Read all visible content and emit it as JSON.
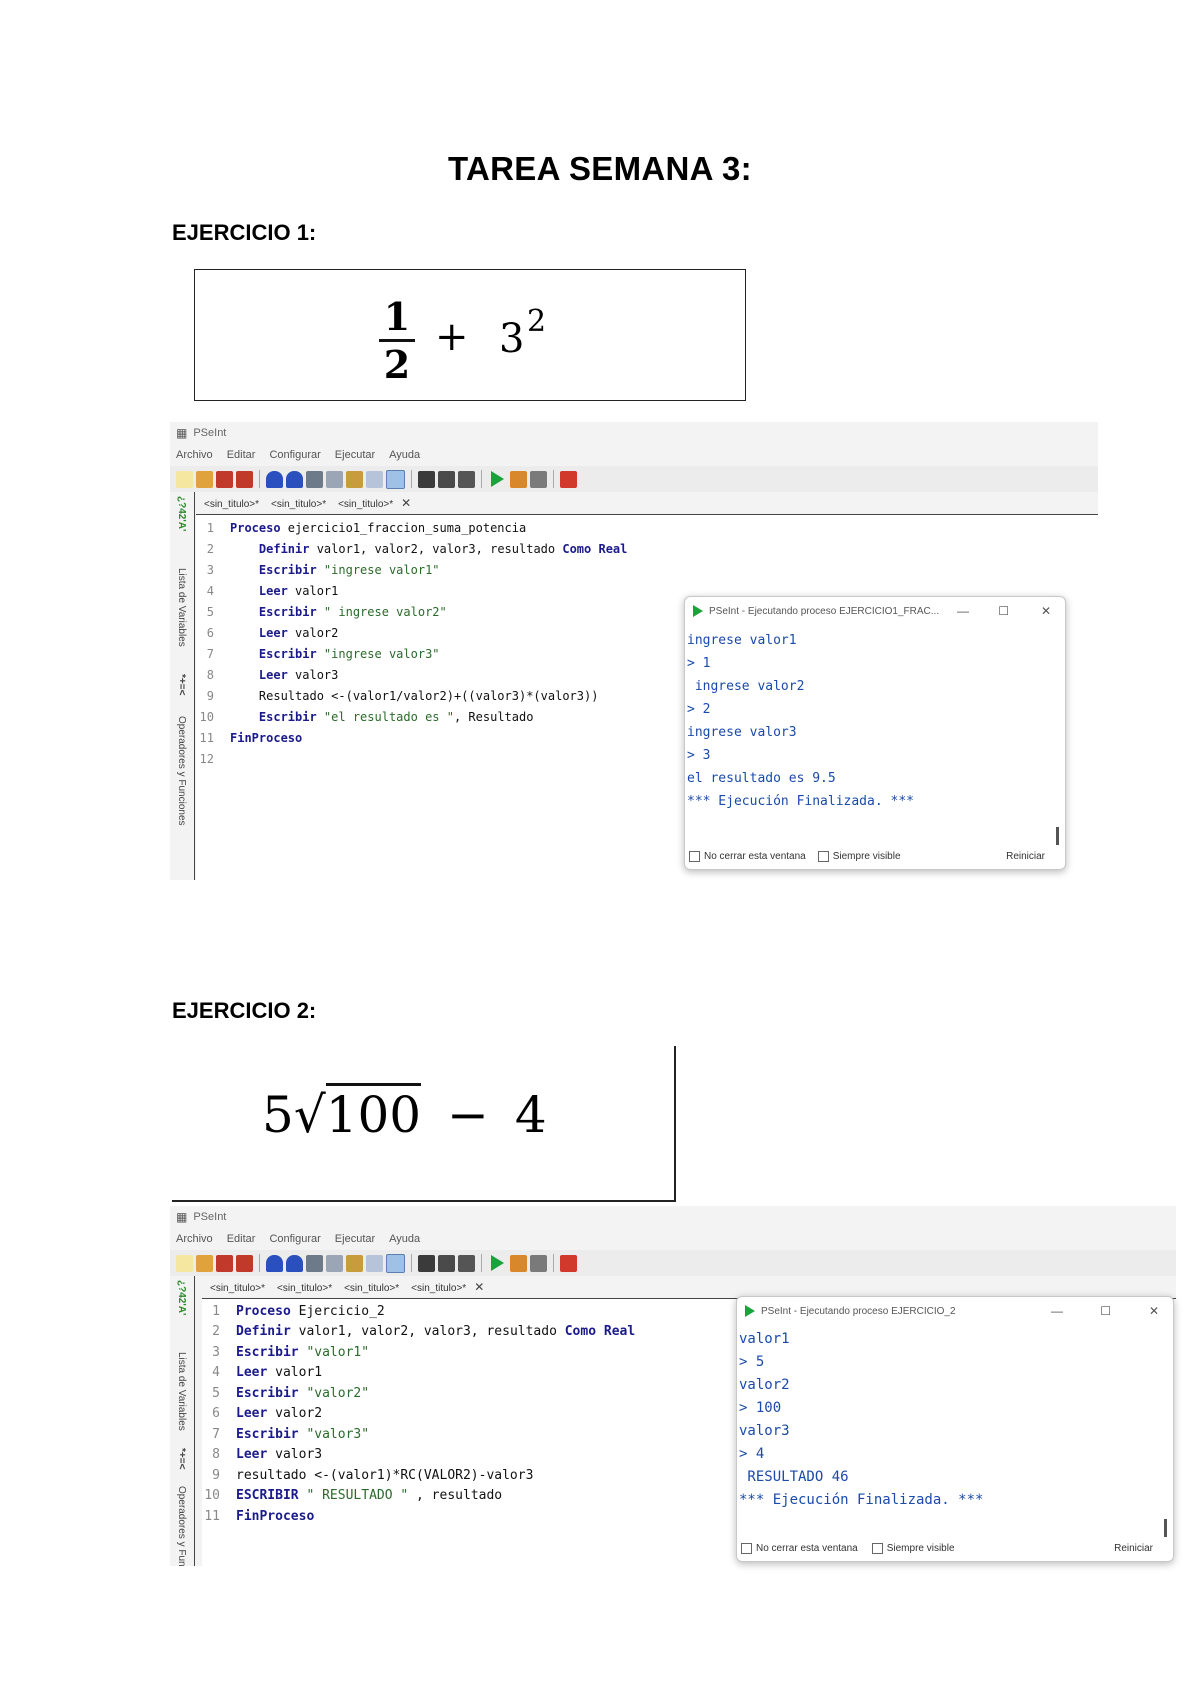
{
  "document": {
    "title": "TAREA SEMANA 3:",
    "ejercicio1_heading": "EJERCICIO 1:",
    "ejercicio2_heading": "EJERCICIO 2:"
  },
  "formula1": {
    "numerator": "1",
    "denominator": "2",
    "plus": "+",
    "base": "3",
    "exponent": "2"
  },
  "formula2": {
    "coef": "5",
    "radical": "√",
    "radicand": "100",
    "minus": "−",
    "term": "4"
  },
  "pseint_common": {
    "app_title": "PSeInt",
    "menu": [
      "Archivo",
      "Editar",
      "Configurar",
      "Ejecutar",
      "Ayuda"
    ],
    "side_label_vars": "Lista de Variables",
    "side_label_ops": "Operadores y Funciones",
    "side_symbols": "*+=<",
    "side_icons_text": "¿?42'A'",
    "tab_close": "✕",
    "console_checkbox_1": "No cerrar esta ventana",
    "console_checkbox_2": "Siempre visible",
    "console_restart": "Reiniciar",
    "win_min": "—",
    "win_max": "☐",
    "win_close": "✕"
  },
  "window1": {
    "tabs": [
      "<sin_titulo>*",
      "<sin_titulo>*",
      "<sin_titulo>*"
    ],
    "code": [
      {
        "n": "1",
        "parts": [
          [
            "kw",
            "Proceso "
          ],
          [
            "plain",
            "ejercicio1_fraccion_suma_potencia"
          ]
        ]
      },
      {
        "n": "2",
        "parts": [
          [
            "kw",
            "    Definir "
          ],
          [
            "plain",
            "valor1, valor2, valor3, resultado "
          ],
          [
            "kw",
            "Como Real"
          ]
        ]
      },
      {
        "n": "3",
        "parts": [
          [
            "kw",
            "    Escribir "
          ],
          [
            "str",
            "\"ingrese valor1\""
          ]
        ]
      },
      {
        "n": "4",
        "parts": [
          [
            "kw",
            "    Leer "
          ],
          [
            "plain",
            "valor1"
          ]
        ]
      },
      {
        "n": "5",
        "parts": [
          [
            "kw",
            "    Escribir "
          ],
          [
            "str",
            "\" ingrese valor2\""
          ]
        ]
      },
      {
        "n": "6",
        "parts": [
          [
            "kw",
            "    Leer "
          ],
          [
            "plain",
            "valor2"
          ]
        ]
      },
      {
        "n": "7",
        "parts": [
          [
            "kw",
            "    Escribir "
          ],
          [
            "str",
            "\"ingrese valor3\""
          ]
        ]
      },
      {
        "n": "8",
        "parts": [
          [
            "kw",
            "    Leer "
          ],
          [
            "plain",
            "valor3"
          ]
        ]
      },
      {
        "n": "9",
        "parts": [
          [
            "plain",
            "    Resultado <-(valor1/valor2)+((valor3)*(valor3))"
          ]
        ]
      },
      {
        "n": "10",
        "parts": [
          [
            "kw",
            "    Escribir "
          ],
          [
            "str",
            "\"el resultado es \""
          ],
          [
            "plain",
            ", Resultado"
          ]
        ]
      },
      {
        "n": "11",
        "parts": [
          [
            "kw",
            "FinProceso"
          ]
        ]
      },
      {
        "n": "12",
        "parts": []
      }
    ],
    "console_title": "PSeInt - Ejecutando proceso EJERCICIO1_FRAC...",
    "console_output": [
      "ingrese valor1",
      "> 1",
      " ingrese valor2",
      "> 2",
      "ingrese valor3",
      "> 3",
      "el resultado es 9.5",
      "*** Ejecución Finalizada. ***"
    ]
  },
  "window2": {
    "tabs": [
      "<sin_titulo>*",
      "<sin_titulo>*",
      "<sin_titulo>*",
      "<sin_titulo>*"
    ],
    "code": [
      {
        "n": "1",
        "parts": [
          [
            "kw",
            "Proceso "
          ],
          [
            "plain",
            "Ejercicio_2"
          ]
        ]
      },
      {
        "n": "2",
        "parts": [
          [
            "kw",
            "Definir "
          ],
          [
            "plain",
            "valor1, valor2, valor3, resultado "
          ],
          [
            "kw",
            "Como Real"
          ]
        ]
      },
      {
        "n": "3",
        "parts": [
          [
            "kw",
            "Escribir "
          ],
          [
            "str",
            "\"valor1\""
          ]
        ]
      },
      {
        "n": "4",
        "parts": [
          [
            "kw",
            "Leer "
          ],
          [
            "plain",
            "valor1"
          ]
        ]
      },
      {
        "n": "5",
        "parts": [
          [
            "kw",
            "Escribir "
          ],
          [
            "str",
            "\"valor2\""
          ]
        ]
      },
      {
        "n": "6",
        "parts": [
          [
            "kw",
            "Leer "
          ],
          [
            "plain",
            "valor2"
          ]
        ]
      },
      {
        "n": "7",
        "parts": [
          [
            "kw",
            "Escribir "
          ],
          [
            "str",
            "\"valor3\""
          ]
        ]
      },
      {
        "n": "8",
        "parts": [
          [
            "kw",
            "Leer "
          ],
          [
            "plain",
            "valor3"
          ]
        ]
      },
      {
        "n": "9",
        "parts": [
          [
            "plain",
            "resultado <-(valor1)*RC(VALOR2)-valor3"
          ]
        ]
      },
      {
        "n": "10",
        "parts": [
          [
            "kw",
            "ESCRIBIR "
          ],
          [
            "str",
            "\" RESULTADO \""
          ],
          [
            "plain",
            " , resultado"
          ]
        ]
      },
      {
        "n": "11",
        "parts": [
          [
            "kw",
            "FinProceso"
          ]
        ]
      }
    ],
    "console_title": "PSeInt - Ejecutando proceso EJERCICIO_2",
    "console_output": [
      "valor1",
      "> 5",
      "valor2",
      "> 100",
      "valor3",
      "> 4",
      " RESULTADO 46",
      "*** Ejecución Finalizada. ***"
    ]
  },
  "colors": {
    "keyword": "#1a1a8c",
    "string": "#2a6a2a",
    "console_text": "#1a4aaa",
    "run_green": "#1aa33a"
  }
}
